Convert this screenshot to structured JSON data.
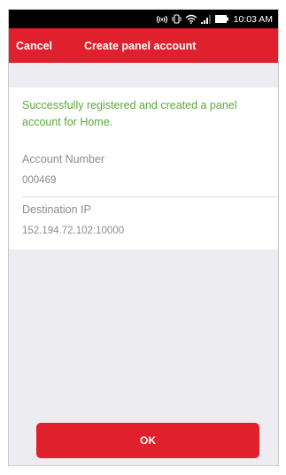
{
  "status_bar": {
    "time": "10:03 AM",
    "icons": [
      "nfc-icon",
      "vibrate-icon",
      "wifi-icon",
      "signal-icon",
      "battery-icon"
    ]
  },
  "nav": {
    "cancel_label": "Cancel",
    "title": "Create panel account"
  },
  "content": {
    "success_message": "Successfully registered and created a panel account for Home.",
    "account_number_label": "Account Number",
    "account_number_value": "000469",
    "destination_ip_label": "Destination IP",
    "destination_ip_value": "152.194.72.102:10000"
  },
  "ok_label": "OK",
  "colors": {
    "accent": "#e0202d",
    "success": "#5ca83a",
    "background": "#ededf1"
  }
}
